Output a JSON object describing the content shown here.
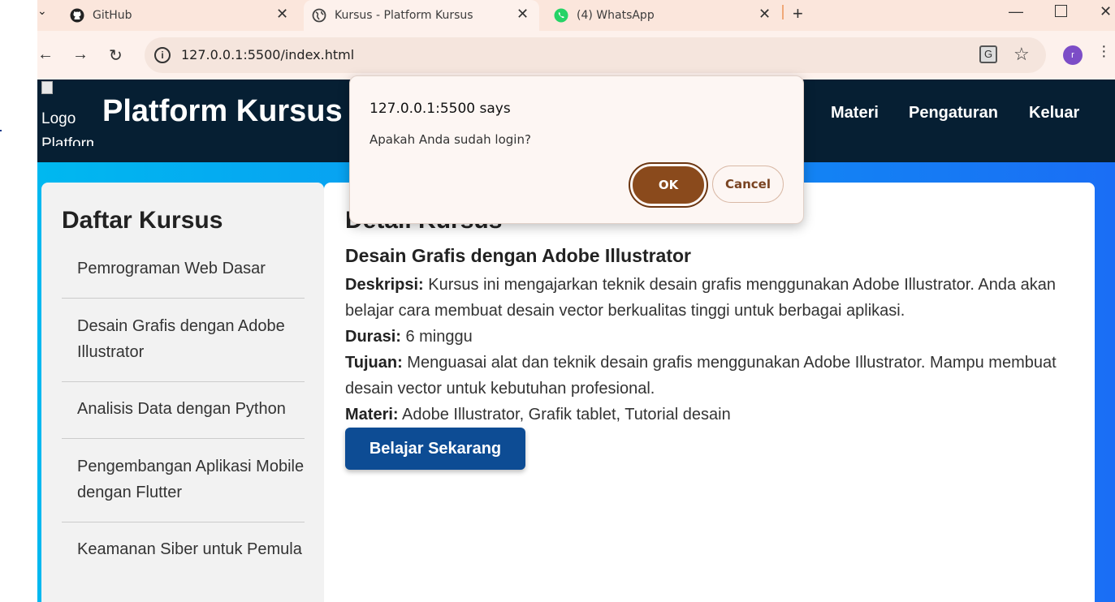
{
  "browser": {
    "tabs": [
      {
        "title": "GitHub",
        "icon": "github-icon"
      },
      {
        "title": "Kursus - Platform Kursus",
        "icon": "globe-icon"
      },
      {
        "title": "(4) WhatsApp",
        "icon": "whatsapp-icon"
      }
    ],
    "url": "127.0.0.1:5500/index.html",
    "profile_initial": "r"
  },
  "site": {
    "logo_alt": "Logo Platform",
    "title": "Platform Kursus",
    "nav": [
      "Materi",
      "Pengaturan",
      "Keluar"
    ]
  },
  "sidebar": {
    "heading": "Daftar Kursus",
    "courses": [
      "Pemrograman Web Dasar",
      "Desain Grafis dengan Adobe Illustrator",
      "Analisis Data dengan Python",
      "Pengembangan Aplikasi Mobile dengan Flutter",
      "Keamanan Siber untuk Pemula"
    ]
  },
  "detail": {
    "heading": "Detail Kursus",
    "course_title": "Desain Grafis dengan Adobe Illustrator",
    "description_label": "Deskripsi:",
    "description": "Kursus ini mengajarkan teknik desain grafis menggunakan Adobe Illustrator. Anda akan belajar cara membuat desain vector berkualitas tinggi untuk berbagai aplikasi.",
    "duration_label": "Durasi:",
    "duration": "6 minggu",
    "goal_label": "Tujuan:",
    "goal": "Menguasai alat dan teknik desain grafis menggunakan Adobe Illustrator. Mampu membuat desain vector untuk kebutuhan profesional.",
    "material_label": "Materi:",
    "material": "Adobe Illustrator, Grafik tablet, Tutorial desain",
    "cta_label": "Belajar Sekarang"
  },
  "dialog": {
    "title": "127.0.0.1:5500 says",
    "message": "Apakah Anda sudah login?",
    "ok_label": "OK",
    "cancel_label": "Cancel"
  },
  "colors": {
    "header_bg": "#061f33",
    "cta_bg": "#0d4c94",
    "ok_bg": "#8a4a1c",
    "tabstrip_bg": "#fbe6dc"
  }
}
